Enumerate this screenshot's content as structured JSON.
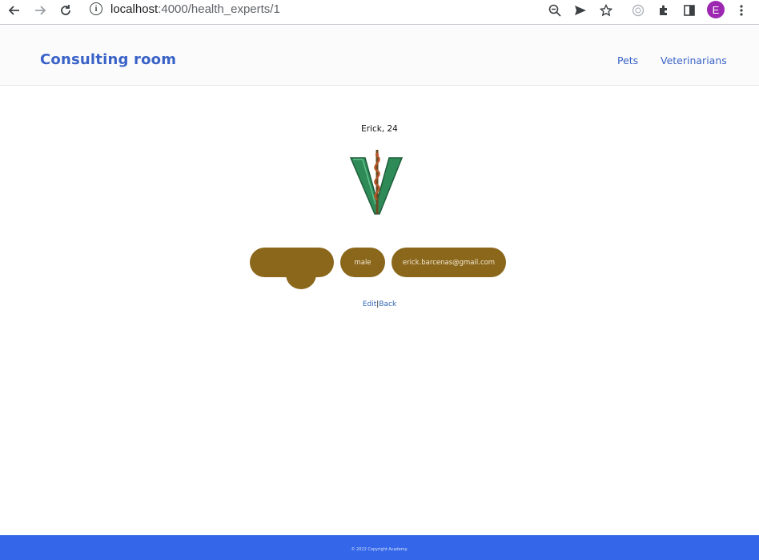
{
  "browser": {
    "url_host": "localhost",
    "url_path": ":4000/health_experts/1",
    "profile_initial": "E"
  },
  "header": {
    "brand": "Consulting room",
    "nav": [
      {
        "label": "Pets"
      },
      {
        "label": "Veterinarians"
      }
    ]
  },
  "expert": {
    "title": "Erick, 24",
    "pills": [
      {
        "label": ""
      },
      {
        "label": "male"
      },
      {
        "label": "erick.barcenas@gmail.com"
      }
    ]
  },
  "actions": {
    "edit": "Edit",
    "separator": "|",
    "back": "Back"
  },
  "footer": {
    "copyright": "© 2022 Copyright Academy."
  },
  "colors": {
    "brand_blue": "#3a63c8",
    "pill_gold": "#8b671c",
    "footer_blue": "#3366e8",
    "logo_green": "#2e8b57"
  },
  "icons": [
    "back-arrow-icon",
    "forward-arrow-icon",
    "reload-icon",
    "info-icon",
    "zoom-out-icon",
    "send-icon",
    "star-icon",
    "extension-puzzle-icon",
    "sidebar-icon",
    "menu-dots-icon",
    "caduceus-logo-icon"
  ]
}
